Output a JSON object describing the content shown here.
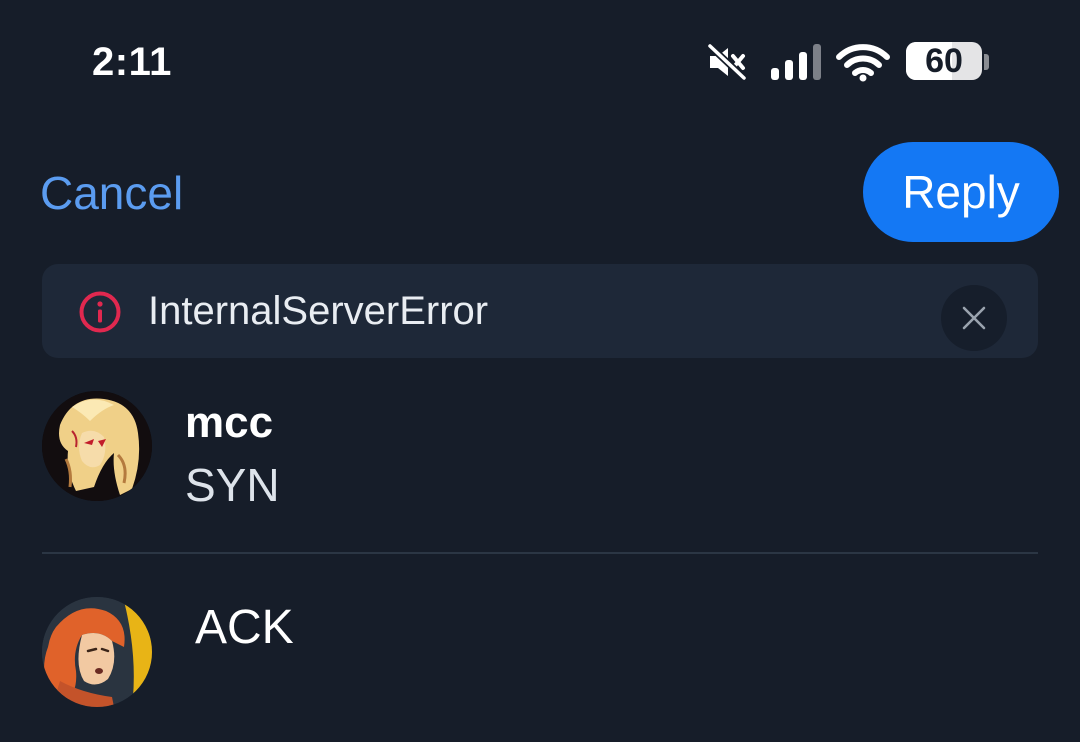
{
  "status_bar": {
    "time": "2:11",
    "battery_level": "60",
    "battery_fraction": 0.6,
    "icons": [
      "mute-icon",
      "signal-icon",
      "wifi-icon",
      "battery-icon"
    ]
  },
  "header": {
    "cancel_label": "Cancel",
    "reply_label": "Reply"
  },
  "error_banner": {
    "message": "InternalServerError",
    "icon": "info-circle-icon",
    "dismiss_icon": "close-icon"
  },
  "parent_post": {
    "author": "mcc",
    "body": "SYN"
  },
  "reply_draft": {
    "text": "ACK"
  },
  "colors": {
    "background": "#161d29",
    "accent": "#1478f4",
    "cancel_link": "#5b9cf0",
    "error_red": "#e0284f",
    "banner_bg": "#1e2838"
  }
}
